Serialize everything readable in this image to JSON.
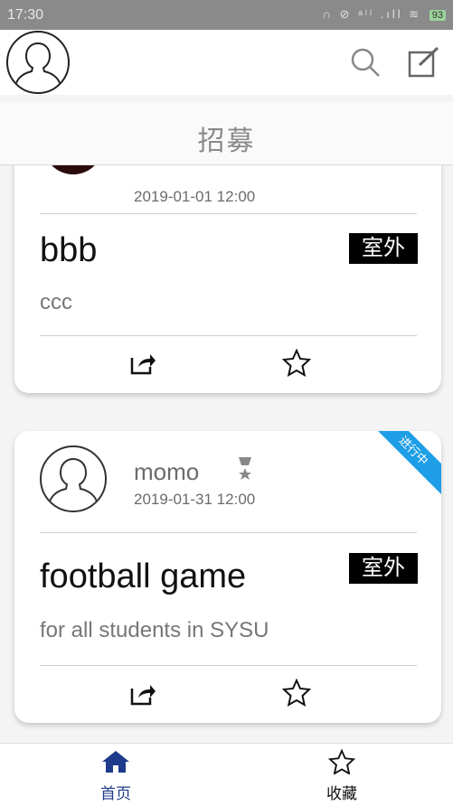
{
  "status_bar": {
    "time": "17:30",
    "indicators": "∩ ⊘ ᵃˡˡ .ıll ≋",
    "battery": "93"
  },
  "header": {
    "title": "招募",
    "icons": [
      "avatar-icon",
      "search-icon",
      "edit-icon"
    ]
  },
  "posts": [
    {
      "time": "2019-01-01 12:00",
      "title": "bbb",
      "tag": "室外",
      "description": "ccc"
    },
    {
      "author": "momo",
      "time": "2019-01-31 12:00",
      "title": "football game",
      "tag": "室外",
      "description": "for all students in SYSU",
      "ribbon": "进行中"
    }
  ],
  "bottom_nav": {
    "items": [
      {
        "label": "首页",
        "icon": "home-icon",
        "active": true
      },
      {
        "label": "收藏",
        "icon": "star-icon",
        "active": false
      }
    ]
  },
  "colors": {
    "accent": "#1e3a8a",
    "ribbon": "#1e9ee6",
    "tag_bg": "#000000"
  }
}
